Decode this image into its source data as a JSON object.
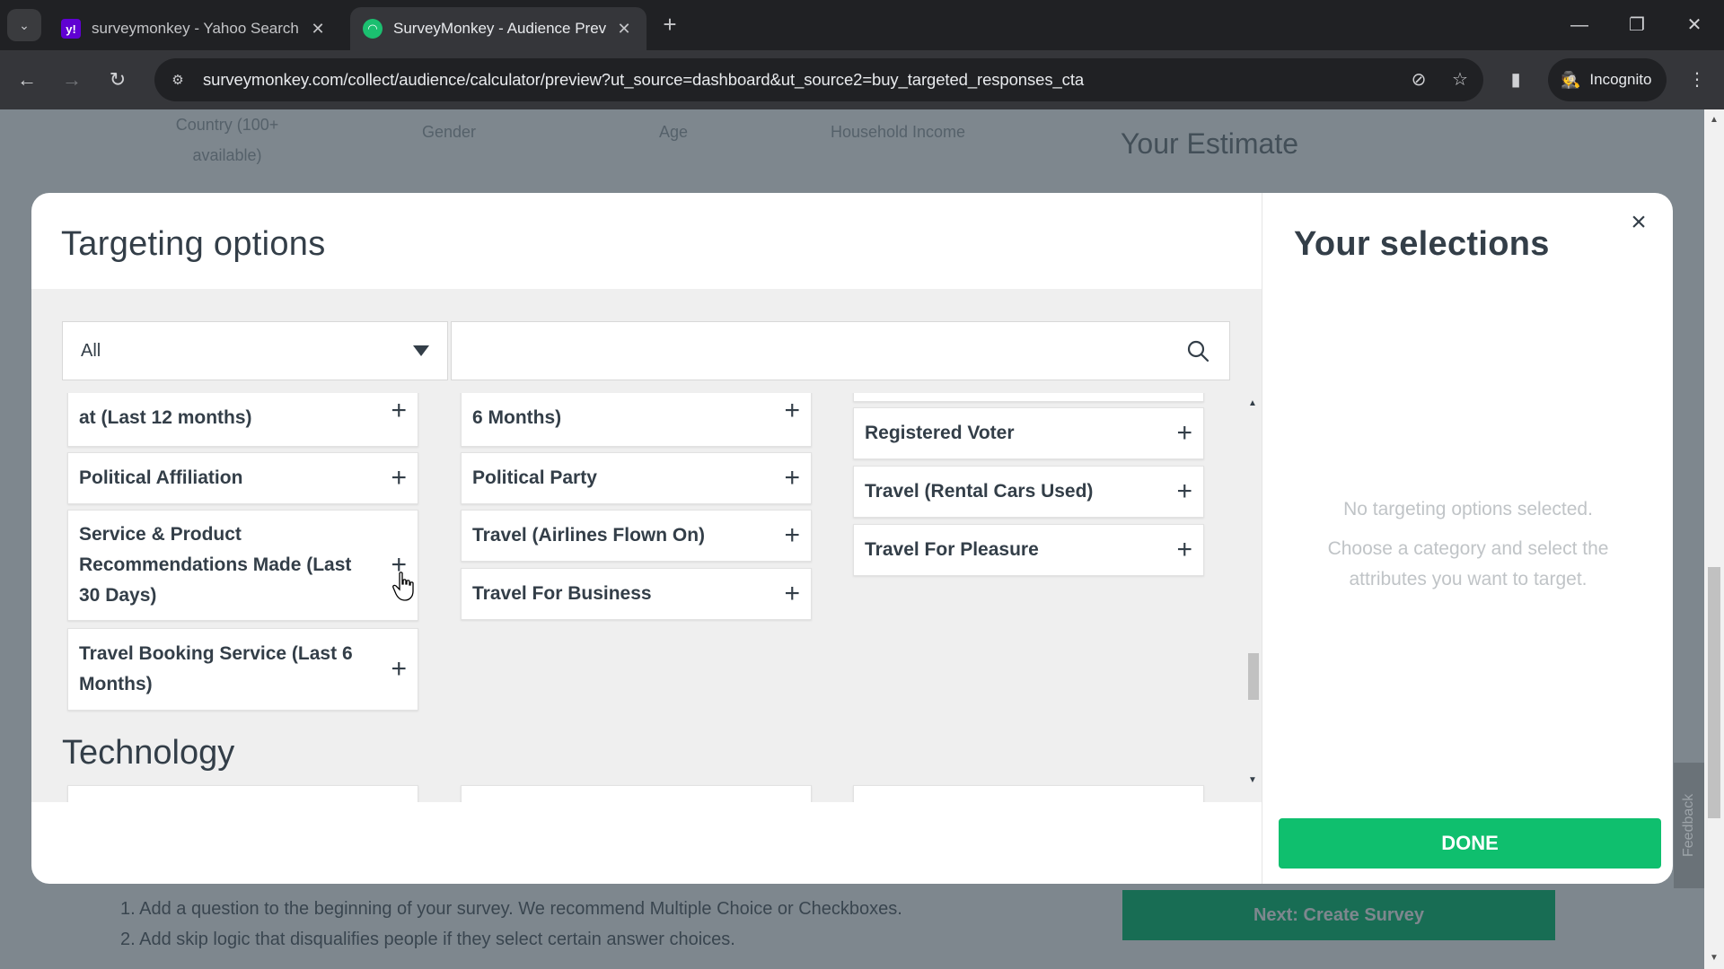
{
  "browser": {
    "tabs": [
      {
        "title": "surveymonkey - Yahoo Search R",
        "favicon": "yahoo-favicon",
        "active": false
      },
      {
        "title": "SurveyMonkey - Audience Prev",
        "favicon": "surveymonkey-favicon",
        "active": true
      }
    ],
    "new_tab": "+",
    "url": "surveymonkey.com/collect/audience/calculator/preview?ut_source=dashboard&ut_source2=buy_targeted_responses_cta",
    "incognito_label": "Incognito",
    "icons": {
      "tab_search": "⌄",
      "back": "←",
      "forward": "→",
      "reload": "↻",
      "site_info": "⚙",
      "eye_off": "⊘",
      "star": "☆",
      "side_panel": "▮",
      "incognito": "🕵",
      "menu": "⋮",
      "minimize": "—",
      "restore": "❐",
      "close": "✕",
      "tab_close": "✕"
    }
  },
  "background_page": {
    "columns": [
      "Country (100+ available)",
      "Gender",
      "Age",
      "Household Income"
    ],
    "estimate_title": "Your Estimate",
    "steps": [
      "1. Add a question to the beginning of your survey. We recommend Multiple Choice or Checkboxes.",
      "2. Add skip logic that disqualifies people if they select certain answer choices."
    ],
    "next_button": "Next: Create Survey",
    "feedback_tab": "Feedback"
  },
  "modal": {
    "title": "Targeting options",
    "filter": {
      "selected": "All"
    },
    "search": {
      "value": "",
      "placeholder": ""
    },
    "columns": [
      [
        {
          "label": "at (Last 12 months)",
          "partial": true
        },
        {
          "label": "Political Affiliation"
        },
        {
          "label": "Service & Product Recommendations Made (Last 30 Days)"
        },
        {
          "label": "Travel Booking Service (Last 6 Months)"
        }
      ],
      [
        {
          "label": "6 Months)",
          "partial": true
        },
        {
          "label": "Political Party"
        },
        {
          "label": "Travel (Airlines Flown On)"
        },
        {
          "label": "Travel For Business"
        }
      ],
      [
        {
          "label": "",
          "partial": true
        },
        {
          "label": "Registered Voter"
        },
        {
          "label": "Travel (Rental Cars Used)"
        },
        {
          "label": "Travel For Pleasure"
        }
      ]
    ],
    "next_section": "Technology",
    "add_icon": "+",
    "selections": {
      "title": "Your selections",
      "empty_line1": "No targeting options selected.",
      "empty_line2": "Choose a category and select the attributes you want to target.",
      "done_label": "DONE",
      "close_icon": "×"
    }
  },
  "colors": {
    "accent_green": "#0fbf6e",
    "text_dark": "#333e48"
  }
}
